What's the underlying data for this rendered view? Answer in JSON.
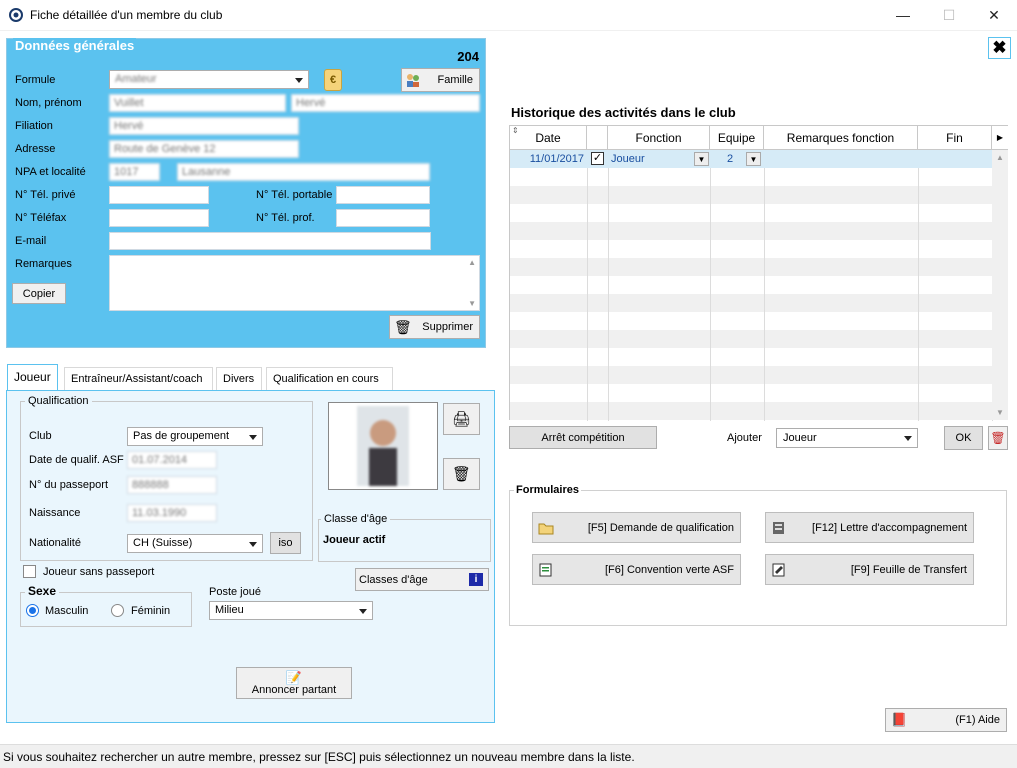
{
  "window": {
    "title": "Fiche détaillée d'un membre du club",
    "minimize": "—",
    "maximize": "☐",
    "close": "✕"
  },
  "general": {
    "title": "Données générales",
    "member_number": "204",
    "labels": {
      "formule": "Formule",
      "nom": "Nom, prénom",
      "filiation": "Filiation",
      "adresse": "Adresse",
      "npa": "NPA et localité",
      "tel_prive": "N° Tél. privé",
      "tel_portable": "N° Tél. portable",
      "telefax": "N° Téléfax",
      "tel_prof": "N° Tél. prof.",
      "email": "E-mail",
      "remarques": "Remarques"
    },
    "values": {
      "formule": "Amateur",
      "nom": "Vuillet",
      "prenom": "Hervé",
      "filiation": "Hervé",
      "adresse": "Route de Genève 12",
      "npa": "1017",
      "localite": "Lausanne"
    },
    "famille_button": "Famille",
    "copier_button": "Copier",
    "supprimer_button": "Supprimer"
  },
  "tabs": [
    "Joueur",
    "Entraîneur/Assistant/coach",
    "Divers",
    "Qualification en cours"
  ],
  "joueur": {
    "qualification_title": "Qualification",
    "club_label": "Club",
    "club_value": "Pas de groupement",
    "date_qualif_label": "Date de qualif. ASF",
    "date_qualif_value": "01.07.2014",
    "passeport_label": "N° du passeport",
    "passeport_value": "888888",
    "naissance_label": "Naissance",
    "naissance_value": "11.03.1990",
    "nationalite_label": "Nationalité",
    "nationalite_value": "CH (Suisse)",
    "iso_button": "iso",
    "sans_passeport": "Joueur sans passeport",
    "sexe_title": "Sexe",
    "masculin": "Masculin",
    "feminin": "Féminin",
    "poste_label": "Poste joué",
    "poste_value": "Milieu",
    "classe_age_title": "Classe d'âge",
    "classe_age_value": "Joueur actif",
    "classes_age_button": "Classes d'âge",
    "annoncer_button": "Annoncer partant"
  },
  "history": {
    "title": "Historique des activités dans le club",
    "columns": [
      "Date",
      "",
      "Fonction",
      "Equipe",
      "Remarques fonction",
      "Fin"
    ],
    "rows": [
      {
        "date": "11/01/2017",
        "checked": true,
        "fonction": "Joueur",
        "equipe": "2",
        "remarques": "",
        "fin": ""
      }
    ],
    "arret_button": "Arrêt compétition",
    "ajouter_label": "Ajouter",
    "ajouter_value": "Joueur",
    "ok_button": "OK"
  },
  "forms": {
    "title": "Formulaires",
    "buttons": [
      {
        "label": "[F5] Demande de qualification",
        "icon": "folder-icon"
      },
      {
        "label": "[F12] Lettre d'accompagnement",
        "icon": "letter-icon"
      },
      {
        "label": "[F6] Convention verte ASF",
        "icon": "convention-icon"
      },
      {
        "label": "[F9] Feuille de Transfert",
        "icon": "transfer-sheet-icon"
      }
    ]
  },
  "help_button": "(F1) Aide",
  "status": "Si vous souhaitez rechercher un autre membre, pressez sur [ESC] puis sélectionnez un nouveau membre dans la liste.",
  "colors": {
    "panel_blue": "#5bc2ef",
    "tab_panel": "#eaf6fd",
    "selected_row": "#d6ebf7"
  }
}
